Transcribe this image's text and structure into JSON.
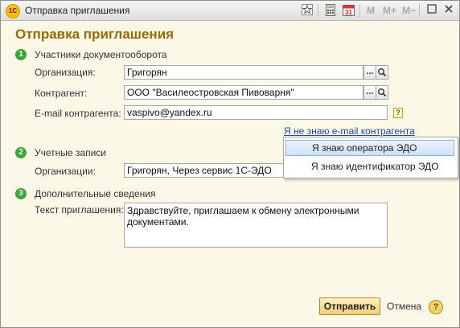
{
  "window": {
    "app_icon": "1C",
    "title": "Отправка приглашения",
    "toolbar": {
      "mem_m": "M",
      "mem_m_plus": "M+",
      "mem_m_minus": "M−"
    }
  },
  "form": {
    "title": "Отправка приглашения",
    "step1": {
      "number": "1",
      "label": "Участники документооборота",
      "organization": {
        "label": "Организация:",
        "value": "Григорян"
      },
      "counterparty": {
        "label": "Контрагент:",
        "value": "ООО \"Василеостровская Пивоварня\""
      },
      "email": {
        "label": "E-mail контрагента:",
        "value": "vaspivo@yandex.ru",
        "hint": "?"
      },
      "unknown_email_link": "Я не знаю e-mail контрагента"
    },
    "step2": {
      "number": "2",
      "label": "Учетные записи",
      "organizations": {
        "label": "Организации:",
        "value": "Григорян, Через сервис 1С-ЭДО"
      }
    },
    "step3": {
      "number": "3",
      "label": "Дополнительные сведения",
      "invite_text": {
        "label": "Текст приглашения:",
        "value": "Здравствуйте, приглашаем к обмену электронными документами."
      }
    },
    "select_button": "...",
    "send_button": "Отправить",
    "cancel_link": "Отмена",
    "help": "?"
  },
  "dropdown": {
    "items": [
      "Я знаю оператора ЭДО",
      "Я знаю идентификатор ЭДО"
    ],
    "selected_index": 0
  },
  "icons": {
    "bookmark": "star-icon",
    "calculator": "calculator-icon",
    "calendar": "calendar-icon",
    "search": "magnifier-icon"
  }
}
